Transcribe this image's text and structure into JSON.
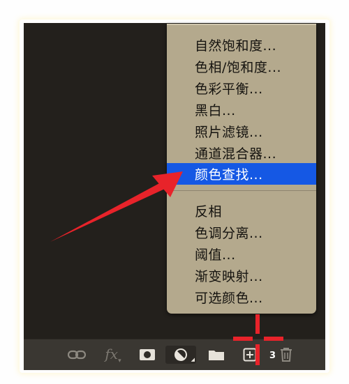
{
  "menu": {
    "items_group1": [
      {
        "label": "自然饱和度..."
      },
      {
        "label": "色相/饱和度..."
      },
      {
        "label": "色彩平衡..."
      },
      {
        "label": "黑白..."
      },
      {
        "label": "照片滤镜..."
      },
      {
        "label": "通道混合器..."
      },
      {
        "label": "颜色查找...",
        "selected": true
      }
    ],
    "items_group2": [
      {
        "label": "反相"
      },
      {
        "label": "色调分离..."
      },
      {
        "label": "阈值..."
      },
      {
        "label": "渐变映射..."
      },
      {
        "label": "可选颜色..."
      }
    ],
    "selected_color": "#1558e4"
  },
  "toolbar": {
    "fx_label": "fx",
    "badge": "3",
    "icons": [
      "link-icon",
      "fx-icon",
      "mask-icon",
      "adjustment-icon",
      "folder-icon",
      "new-layer-icon",
      "trash-icon"
    ]
  },
  "annotation": {
    "arrow_color": "#e8232a",
    "crosshair_color": "#e8232a"
  }
}
